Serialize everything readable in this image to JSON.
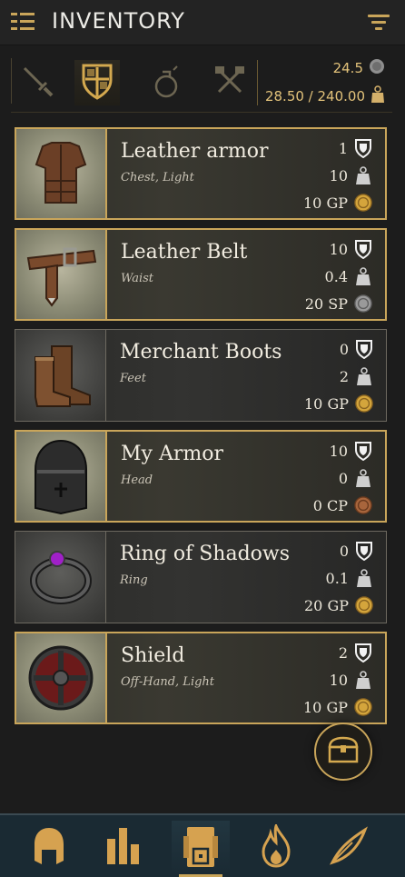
{
  "header": {
    "title": "INVENTORY",
    "menu_icon": "hamburger-icon",
    "filter_icon": "filter-icon"
  },
  "categories": [
    {
      "name": "weapons",
      "icon": "sword-icon",
      "active": false
    },
    {
      "name": "armor",
      "icon": "shield-icon",
      "active": true
    },
    {
      "name": "potions",
      "icon": "potion-icon",
      "active": false
    },
    {
      "name": "tools",
      "icon": "tools-icon",
      "active": false
    }
  ],
  "stats": {
    "coins": "24.5",
    "weight": "28.50 / 240.00"
  },
  "items": [
    {
      "name": "Leather armor",
      "sub": "Chest, Light",
      "armor": "1",
      "weight": "10",
      "price": "10 GP",
      "coin": "gold",
      "equipped": true
    },
    {
      "name": "Leather Belt",
      "sub": "Waist",
      "armor": "10",
      "weight": "0.4",
      "price": "20 SP",
      "coin": "silver",
      "equipped": true
    },
    {
      "name": "Merchant Boots",
      "sub": "Feet",
      "armor": "0",
      "weight": "2",
      "price": "10 GP",
      "coin": "gold",
      "equipped": false
    },
    {
      "name": "My Armor",
      "sub": "Head",
      "armor": "10",
      "weight": "0",
      "price": "0 CP",
      "coin": "copper",
      "equipped": true
    },
    {
      "name": "Ring of Shadows",
      "sub": "Ring",
      "armor": "0",
      "weight": "0.1",
      "price": "20 GP",
      "coin": "gold",
      "equipped": false
    },
    {
      "name": "Shield",
      "sub": "Off-Hand, Light",
      "armor": "2",
      "weight": "10",
      "price": "10 GP",
      "coin": "gold",
      "equipped": true
    }
  ],
  "colors": {
    "accent": "#c9a55a",
    "gold": "#d4a53c",
    "silver": "#9a9a9a",
    "copper": "#a8653c",
    "nav_bg": "#1a2a33"
  },
  "nav": [
    {
      "name": "character",
      "icon": "helmet-icon",
      "active": false
    },
    {
      "name": "stats",
      "icon": "bars-icon",
      "active": false
    },
    {
      "name": "inventory",
      "icon": "backpack-icon",
      "active": true
    },
    {
      "name": "spells",
      "icon": "flame-icon",
      "active": false
    },
    {
      "name": "notes",
      "icon": "quill-icon",
      "active": false
    }
  ]
}
